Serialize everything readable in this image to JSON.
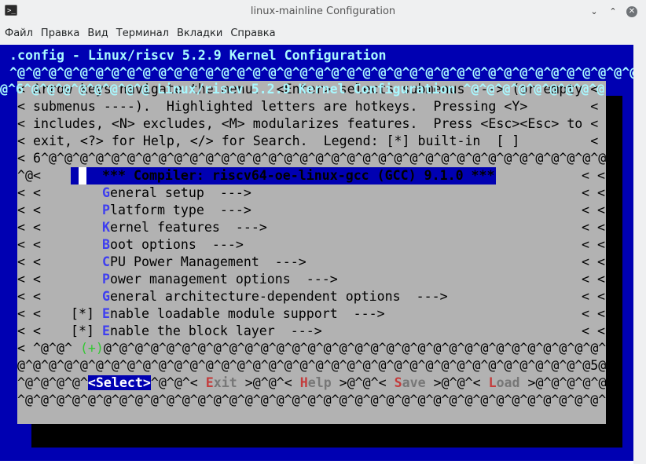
{
  "window": {
    "title": "linux-mainline Configuration",
    "icon": "terminal-icon",
    "controls": {
      "minimize": "⌄",
      "maximize": "⌃",
      "close": "✕"
    }
  },
  "menubar": [
    "Файл",
    "Правка",
    "Вид",
    "Терминал",
    "Вкладки",
    "Справка"
  ],
  "terminal": {
    "header": ".config - Linux/riscv 5.2.9 Kernel Configuration",
    "top_rule": "^@^@^@^@^@^@^@^@^@^@^@^@^@^@^@^@^@^@^@^@^@^@^@^@^@^@^@^@^@^@^@^@^@^@^@^@^@^@^@^@^@^@^@^@^@^@^@^@^@^@^@^@^@^@^@^@^@^@^@^@^@^@^@^@^@^@^@^@^@^@^@^@^@^@^@^@^@^@^@^@^@^@^@^@^@^@^@^@^@^@^@^@^@^@^@^@^@^@^@^@^@^@^@^@^@^@^@^@^@^@^@^@^@^@^@^@^@^@^@^@^@^@^@^@^@^@^@^@^@^@^@^@^@^@^@^@^@^@^@^@^@^@^@^@^@^@^@^@^@^@^@^@^@^@^@^@^@^@^@^@^@^@^@^@^@^@^@^@^@^@^@^@^@^@",
    "box_title_prefix": "@^6^@^@^@^@^@^@^@^@ ",
    "box_title": "Linux/riscv 5.2.9 Kernel Configuration",
    "box_title_suffix": " ^@^@^@^@^@^@^@^@^@",
    "help_lines": [
      "< Arrow keys navigate the menu.  <Enter> selects submenus ---> (or empty <",
      "< submenus ----).  Highlighted letters are hotkeys.  Pressing <Y>        <",
      "< includes, <N> excludes, <M> modularizes features.  Press <Esc><Esc> to <",
      "< exit, <?> for Help, </> for Search.  Legend: [*] built-in  [ ]         <"
    ],
    "rule_mid": "< 6^@^@^@^@^@^@^@^@^@^@^@^@^@^@^@^@^@^@^@^@^@^@^@^@^@^@^@^@^@^@^@^@^@^@^@^@^@^@^@^@^@^@^@^@",
    "selected_prefix": "^@<",
    "selected_item": "*** Compiler: riscv64-oe-linux-gcc (GCC) 9.1.0 ***",
    "right_edge": "< <",
    "menu_items": [
      {
        "hot": "G",
        "rest": "eneral setup  --->"
      },
      {
        "hot": "P",
        "rest": "latform type  --->"
      },
      {
        "hot": "K",
        "rest": "ernel features  --->"
      },
      {
        "hot": "B",
        "rest": "oot options  --->"
      },
      {
        "hot": "C",
        "rest": "PU Power Management  --->"
      },
      {
        "hot": "P",
        "rest": "ower management options  --->"
      },
      {
        "hot": "G",
        "rest": "eneral architecture-dependent options  --->"
      },
      {
        "mark": "[*]",
        "hot": "E",
        "rest": "nable loadable module support  --->"
      },
      {
        "mark": "[*]",
        "hot": "E",
        "rest": "nable the block layer  --->"
      }
    ],
    "bottom_rule_prefix": "< ^@^@^ ",
    "more_indicator": "(+)",
    "bottom_rule_rest": "@^@^@^@^@^@^@^@^@^@^@^@^@^@^@^@^@^@^@^@^@^@^@^@^@^@^@^@^@^@^@^@^@^@^@^@^@^@^@^@^@^@^@^@",
    "rule_low": "@^@^@^@^@^@^@^@^@^@^@^@^@^@^@^@^@^@^@^@^@^@^@^@^@^@^@^@^@^@^@^@^@^@^@^@^@5@^@^@^@^@",
    "buttons_lead": "^@^@^@^@^",
    "buttons": [
      {
        "label": "<Select>",
        "selected": true
      },
      {
        "sep": "^@^@^< ",
        "hot": "E",
        "rest": "xit",
        "close": " >"
      },
      {
        "sep": "@^@^< ",
        "hot": "H",
        "rest": "elp",
        "close": " >"
      },
      {
        "sep": "@^@^< ",
        "hot": "S",
        "rest": "ave",
        "close": " >"
      },
      {
        "sep": "@^@^< ",
        "hot": "L",
        "rest": "oad",
        "close": " >"
      }
    ],
    "buttons_tail": "@^@^@^@^@<",
    "last_rule": "^@^@^@^@^@^@^@^@^@^@^@^@^@^@^@^@^@^@^@^@^@^@^@^@^@^@^@^@^@^@^@^@^@^@^@^@^@^@^@^@^@^@^@^@^@5"
  },
  "colors": {
    "terminal_bg": "#0000b2",
    "dialog_bg": "#b2b2b2",
    "title_cyan": "#a8f8ff",
    "hotkey_blue": "#3e3ef0",
    "hotkey_red": "#c43c3c"
  }
}
